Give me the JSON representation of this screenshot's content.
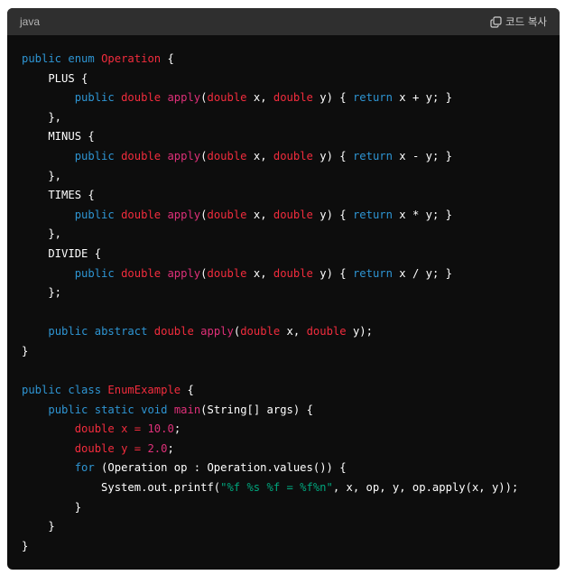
{
  "header": {
    "language": "java",
    "copy_label": "코드 복사",
    "copy_icon": "copy-icon"
  },
  "colors": {
    "background": "#0d0d0d",
    "header_background": "#2f2f2f",
    "keyword": "#2e95d3",
    "type_name": "#f22c3d",
    "function": "#df3079",
    "number": "#df3079",
    "string": "#00a67d",
    "plain": "#ffffff"
  },
  "code_lines": [
    [
      [
        "kw",
        "public"
      ],
      [
        "p",
        " "
      ],
      [
        "kw",
        "enum"
      ],
      [
        "p",
        " "
      ],
      [
        "cls",
        "Operation"
      ],
      [
        "p",
        " {"
      ]
    ],
    [
      [
        "p",
        "    PLUS {"
      ]
    ],
    [
      [
        "p",
        "        "
      ],
      [
        "kw",
        "public"
      ],
      [
        "p",
        " "
      ],
      [
        "type",
        "double"
      ],
      [
        "p",
        " "
      ],
      [
        "fn",
        "apply"
      ],
      [
        "p",
        "("
      ],
      [
        "type",
        "double"
      ],
      [
        "p",
        " x, "
      ],
      [
        "type",
        "double"
      ],
      [
        "p",
        " y) { "
      ],
      [
        "kw",
        "return"
      ],
      [
        "p",
        " x + y; }"
      ]
    ],
    [
      [
        "p",
        "    },"
      ]
    ],
    [
      [
        "p",
        "    MINUS {"
      ]
    ],
    [
      [
        "p",
        "        "
      ],
      [
        "kw",
        "public"
      ],
      [
        "p",
        " "
      ],
      [
        "type",
        "double"
      ],
      [
        "p",
        " "
      ],
      [
        "fn",
        "apply"
      ],
      [
        "p",
        "("
      ],
      [
        "type",
        "double"
      ],
      [
        "p",
        " x, "
      ],
      [
        "type",
        "double"
      ],
      [
        "p",
        " y) { "
      ],
      [
        "kw",
        "return"
      ],
      [
        "p",
        " x - y; }"
      ]
    ],
    [
      [
        "p",
        "    },"
      ]
    ],
    [
      [
        "p",
        "    TIMES {"
      ]
    ],
    [
      [
        "p",
        "        "
      ],
      [
        "kw",
        "public"
      ],
      [
        "p",
        " "
      ],
      [
        "type",
        "double"
      ],
      [
        "p",
        " "
      ],
      [
        "fn",
        "apply"
      ],
      [
        "p",
        "("
      ],
      [
        "type",
        "double"
      ],
      [
        "p",
        " x, "
      ],
      [
        "type",
        "double"
      ],
      [
        "p",
        " y) { "
      ],
      [
        "kw",
        "return"
      ],
      [
        "p",
        " x * y; }"
      ]
    ],
    [
      [
        "p",
        "    },"
      ]
    ],
    [
      [
        "p",
        "    DIVIDE {"
      ]
    ],
    [
      [
        "p",
        "        "
      ],
      [
        "kw",
        "public"
      ],
      [
        "p",
        " "
      ],
      [
        "type",
        "double"
      ],
      [
        "p",
        " "
      ],
      [
        "fn",
        "apply"
      ],
      [
        "p",
        "("
      ],
      [
        "type",
        "double"
      ],
      [
        "p",
        " x, "
      ],
      [
        "type",
        "double"
      ],
      [
        "p",
        " y) { "
      ],
      [
        "kw",
        "return"
      ],
      [
        "p",
        " x / y; }"
      ]
    ],
    [
      [
        "p",
        "    };"
      ]
    ],
    [
      [
        "p",
        ""
      ]
    ],
    [
      [
        "p",
        "    "
      ],
      [
        "kw",
        "public"
      ],
      [
        "p",
        " "
      ],
      [
        "kw",
        "abstract"
      ],
      [
        "p",
        " "
      ],
      [
        "type",
        "double"
      ],
      [
        "p",
        " "
      ],
      [
        "fn",
        "apply"
      ],
      [
        "p",
        "("
      ],
      [
        "type",
        "double"
      ],
      [
        "p",
        " x, "
      ],
      [
        "type",
        "double"
      ],
      [
        "p",
        " y);"
      ]
    ],
    [
      [
        "p",
        "}"
      ]
    ],
    [
      [
        "p",
        ""
      ]
    ],
    [
      [
        "kw",
        "public"
      ],
      [
        "p",
        " "
      ],
      [
        "kw",
        "class"
      ],
      [
        "p",
        " "
      ],
      [
        "cls",
        "EnumExample"
      ],
      [
        "p",
        " {"
      ]
    ],
    [
      [
        "p",
        "    "
      ],
      [
        "kw",
        "public"
      ],
      [
        "p",
        " "
      ],
      [
        "kw",
        "static"
      ],
      [
        "p",
        " "
      ],
      [
        "kw",
        "void"
      ],
      [
        "p",
        " "
      ],
      [
        "fn",
        "main"
      ],
      [
        "p",
        "(String[] args) {"
      ]
    ],
    [
      [
        "p",
        "        "
      ],
      [
        "type",
        "double"
      ],
      [
        "p",
        " "
      ],
      [
        "type",
        "x"
      ],
      [
        "p",
        " "
      ],
      [
        "type",
        "="
      ],
      [
        "p",
        " "
      ],
      [
        "num",
        "10.0"
      ],
      [
        "p",
        ";"
      ]
    ],
    [
      [
        "p",
        "        "
      ],
      [
        "type",
        "double"
      ],
      [
        "p",
        " "
      ],
      [
        "type",
        "y"
      ],
      [
        "p",
        " "
      ],
      [
        "type",
        "="
      ],
      [
        "p",
        " "
      ],
      [
        "num",
        "2.0"
      ],
      [
        "p",
        ";"
      ]
    ],
    [
      [
        "p",
        "        "
      ],
      [
        "kw",
        "for"
      ],
      [
        "p",
        " (Operation op : Operation.values()) {"
      ]
    ],
    [
      [
        "p",
        "            System.out.printf("
      ],
      [
        "str",
        "\"%f %s %f = %f%n\""
      ],
      [
        "p",
        ", x, op, y, op.apply(x, y));"
      ]
    ],
    [
      [
        "p",
        "        }"
      ]
    ],
    [
      [
        "p",
        "    }"
      ]
    ],
    [
      [
        "p",
        "}"
      ]
    ]
  ]
}
